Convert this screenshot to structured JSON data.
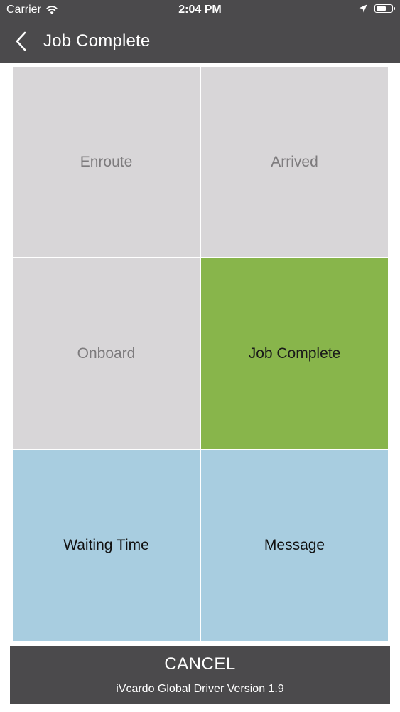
{
  "status_bar": {
    "carrier": "Carrier",
    "time": "2:04 PM",
    "battery_level": 0.65,
    "icons": [
      "wifi-icon",
      "location-arrow-icon",
      "battery-icon"
    ]
  },
  "nav": {
    "back_icon": "chevron-left-icon",
    "title": "Job Complete"
  },
  "tiles": [
    {
      "label": "Enroute",
      "state": "inactive"
    },
    {
      "label": "Arrived",
      "state": "inactive"
    },
    {
      "label": "Onboard",
      "state": "inactive"
    },
    {
      "label": "Job Complete",
      "state": "active"
    },
    {
      "label": "Waiting Time",
      "state": "action"
    },
    {
      "label": "Message",
      "state": "action"
    }
  ],
  "footer": {
    "cancel_label": "CANCEL",
    "version_text": "iVcardo Global Driver Version 1.9"
  },
  "colors": {
    "header_bg": "#4b4a4c",
    "inactive_tile": "#d8d6d8",
    "active_tile": "#88b54b",
    "action_tile": "#a8cde0"
  }
}
